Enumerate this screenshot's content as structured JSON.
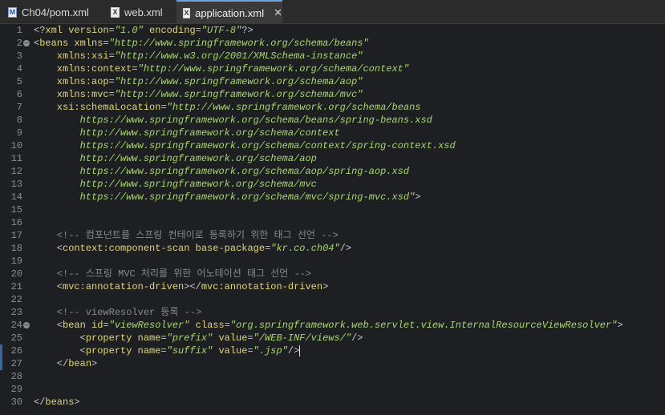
{
  "tabs": [
    {
      "label": "Ch04/pom.xml",
      "icon": "maven-pom-file-icon",
      "icon_letter": "M",
      "active": false
    },
    {
      "label": "web.xml",
      "icon": "xml-file-icon",
      "icon_letter": "X",
      "active": false
    },
    {
      "label": "application.xml",
      "icon": "xml-file-icon",
      "icon_letter": "X",
      "active": true,
      "close": "✕"
    }
  ],
  "fold_marker": "−",
  "colors": {
    "background": "#1e1f22",
    "tag": "#e0d776",
    "string": "#a8d86d",
    "comment": "#8a8a8a",
    "punctuation": "#c8c8c8",
    "line_number": "#8c8c8c"
  },
  "editor": {
    "cursor_line": 26,
    "lines": [
      {
        "n": "1",
        "tokens": [
          [
            "punc",
            "<?"
          ],
          [
            "pi",
            "xml version"
          ],
          [
            "punc",
            "="
          ],
          [
            "str",
            "\"1.0\""
          ],
          [
            "pi",
            " encoding"
          ],
          [
            "punc",
            "="
          ],
          [
            "str",
            "\"UTF-8\""
          ],
          [
            "punc",
            "?>"
          ]
        ]
      },
      {
        "n": "2",
        "fold": true,
        "tokens": [
          [
            "punc",
            "<"
          ],
          [
            "tag",
            "beans"
          ],
          [
            "attr",
            " xmlns"
          ],
          [
            "punc",
            "="
          ],
          [
            "str",
            "\"http://www.springframework.org/schema/beans\""
          ]
        ]
      },
      {
        "n": "3",
        "tokens": [
          [
            "attr",
            "    xmlns:xsi"
          ],
          [
            "punc",
            "="
          ],
          [
            "str",
            "\"http://www.w3.org/2001/XMLSchema-instance\""
          ]
        ]
      },
      {
        "n": "4",
        "tokens": [
          [
            "attr",
            "    xmlns:context"
          ],
          [
            "punc",
            "="
          ],
          [
            "str",
            "\"http://www.springframework.org/schema/context\""
          ]
        ]
      },
      {
        "n": "5",
        "tokens": [
          [
            "attr",
            "    xmlns:aop"
          ],
          [
            "punc",
            "="
          ],
          [
            "str",
            "\"http://www.springframework.org/schema/aop\""
          ]
        ]
      },
      {
        "n": "6",
        "tokens": [
          [
            "attr",
            "    xmlns:mvc"
          ],
          [
            "punc",
            "="
          ],
          [
            "str",
            "\"http://www.springframework.org/schema/mvc\""
          ]
        ]
      },
      {
        "n": "7",
        "tokens": [
          [
            "attr",
            "    xsi:schemaLocation"
          ],
          [
            "punc",
            "="
          ],
          [
            "str",
            "\"http://www.springframework.org/schema/beans"
          ]
        ]
      },
      {
        "n": "8",
        "tokens": [
          [
            "str",
            "        https://www.springframework.org/schema/beans/spring-beans.xsd"
          ]
        ]
      },
      {
        "n": "9",
        "tokens": [
          [
            "str",
            "        http://www.springframework.org/schema/context"
          ]
        ]
      },
      {
        "n": "10",
        "tokens": [
          [
            "str",
            "        https://www.springframework.org/schema/context/spring-context.xsd"
          ]
        ]
      },
      {
        "n": "11",
        "tokens": [
          [
            "str",
            "        http://www.springframework.org/schema/aop"
          ]
        ]
      },
      {
        "n": "12",
        "tokens": [
          [
            "str",
            "        https://www.springframework.org/schema/aop/spring-aop.xsd"
          ]
        ]
      },
      {
        "n": "13",
        "tokens": [
          [
            "str",
            "        http://www.springframework.org/schema/mvc"
          ]
        ]
      },
      {
        "n": "14",
        "tokens": [
          [
            "str",
            "        https://www.springframework.org/schema/mvc/spring-mvc.xsd\""
          ],
          [
            "punc",
            ">"
          ]
        ]
      },
      {
        "n": "15",
        "tokens": []
      },
      {
        "n": "16",
        "tokens": []
      },
      {
        "n": "17",
        "tokens": [
          [
            "com",
            "    <!-- 컴포넌트를 스프링 컨테이로 등록하기 위한 태그 선언 -->"
          ]
        ]
      },
      {
        "n": "18",
        "tokens": [
          [
            "punc",
            "    <"
          ],
          [
            "tag",
            "context:component-scan"
          ],
          [
            "attr",
            " base-package"
          ],
          [
            "punc",
            "="
          ],
          [
            "str",
            "\"kr.co.ch04\""
          ],
          [
            "punc",
            "/>"
          ]
        ]
      },
      {
        "n": "19",
        "tokens": []
      },
      {
        "n": "20",
        "tokens": [
          [
            "com",
            "    <!-- 스프링 MVC 처리를 위한 어노테이션 태그 선언 -->"
          ]
        ]
      },
      {
        "n": "21",
        "tokens": [
          [
            "punc",
            "    <"
          ],
          [
            "tag",
            "mvc:annotation-driven"
          ],
          [
            "punc",
            "></"
          ],
          [
            "tag",
            "mvc:annotation-driven"
          ],
          [
            "punc",
            ">"
          ]
        ]
      },
      {
        "n": "22",
        "tokens": []
      },
      {
        "n": "23",
        "tokens": [
          [
            "com",
            "    <!-- viewResolver 등록 -->"
          ]
        ]
      },
      {
        "n": "24",
        "fold": true,
        "tokens": [
          [
            "punc",
            "    <"
          ],
          [
            "tag",
            "bean"
          ],
          [
            "attr",
            " id"
          ],
          [
            "punc",
            "="
          ],
          [
            "str",
            "\"viewResolver\""
          ],
          [
            "attr",
            " class"
          ],
          [
            "punc",
            "="
          ],
          [
            "str",
            "\"org.springframework.web.servlet.view.InternalResourceViewResolver\""
          ],
          [
            "punc",
            ">"
          ]
        ]
      },
      {
        "n": "25",
        "tokens": [
          [
            "punc",
            "        <"
          ],
          [
            "tag",
            "property"
          ],
          [
            "attr",
            " name"
          ],
          [
            "punc",
            "="
          ],
          [
            "str",
            "\"prefix\""
          ],
          [
            "attr",
            " value"
          ],
          [
            "punc",
            "="
          ],
          [
            "str",
            "\"/WEB-INF/views/\""
          ],
          [
            "punc",
            "/>"
          ]
        ]
      },
      {
        "n": "26",
        "marker": true,
        "tokens": [
          [
            "punc",
            "        <"
          ],
          [
            "tag",
            "property"
          ],
          [
            "attr",
            " name"
          ],
          [
            "punc",
            "="
          ],
          [
            "str",
            "\"suffix\""
          ],
          [
            "attr",
            " value"
          ],
          [
            "punc",
            "="
          ],
          [
            "str",
            "\".jsp\""
          ],
          [
            "punc",
            "/>"
          ]
        ]
      },
      {
        "n": "27",
        "marker": true,
        "tokens": [
          [
            "punc",
            "    </"
          ],
          [
            "tag",
            "bean"
          ],
          [
            "punc",
            ">"
          ]
        ]
      },
      {
        "n": "28",
        "tokens": []
      },
      {
        "n": "29",
        "tokens": []
      },
      {
        "n": "30",
        "tokens": [
          [
            "punc",
            "</"
          ],
          [
            "tag",
            "beans"
          ],
          [
            "punc",
            ">"
          ]
        ]
      }
    ]
  }
}
